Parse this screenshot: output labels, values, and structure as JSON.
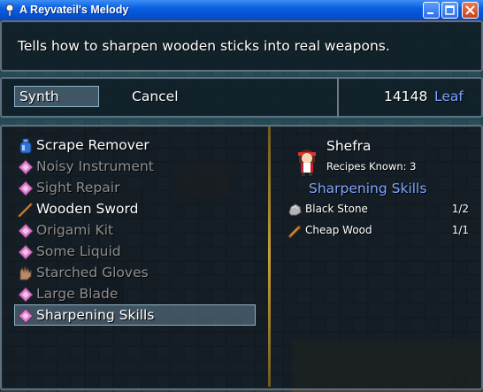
{
  "window": {
    "title": "A Reyvateil's Melody"
  },
  "help": {
    "text": "Tells how to sharpen wooden sticks into real weapons."
  },
  "commands": {
    "synth": "Synth",
    "cancel": "Cancel",
    "money": "14148",
    "currency": "Leaf"
  },
  "items": [
    {
      "label": "Scrape Remover",
      "icon": "bottle-icon",
      "enabled": true
    },
    {
      "label": "Noisy Instrument",
      "icon": "recipe-diamond-icon",
      "enabled": false
    },
    {
      "label": "Sight Repair",
      "icon": "recipe-diamond-icon",
      "enabled": false
    },
    {
      "label": "Wooden Sword",
      "icon": "sword-icon",
      "enabled": true
    },
    {
      "label": "Origami Kit",
      "icon": "recipe-diamond-icon",
      "enabled": false
    },
    {
      "label": "Some Liquid",
      "icon": "recipe-diamond-icon",
      "enabled": false
    },
    {
      "label": "Starched Gloves",
      "icon": "gloves-icon",
      "enabled": false
    },
    {
      "label": "Large Blade",
      "icon": "recipe-diamond-icon",
      "enabled": false
    },
    {
      "label": "Sharpening Skills",
      "icon": "recipe-diamond-icon",
      "enabled": true,
      "selected": true
    }
  ],
  "detail": {
    "character": "Shefra",
    "recipes_known": "Recipes Known: 3",
    "recipe": "Sharpening Skills",
    "ingredients": [
      {
        "name": "Black Stone",
        "qty": "1/2",
        "icon": "stone-icon"
      },
      {
        "name": "Cheap Wood",
        "qty": "1/1",
        "icon": "wood-icon"
      }
    ]
  },
  "colors": {
    "accent": "#7ea6ff",
    "disabled": "#8e8e8e",
    "text": "#ffffff",
    "divider": "#c9a338"
  }
}
